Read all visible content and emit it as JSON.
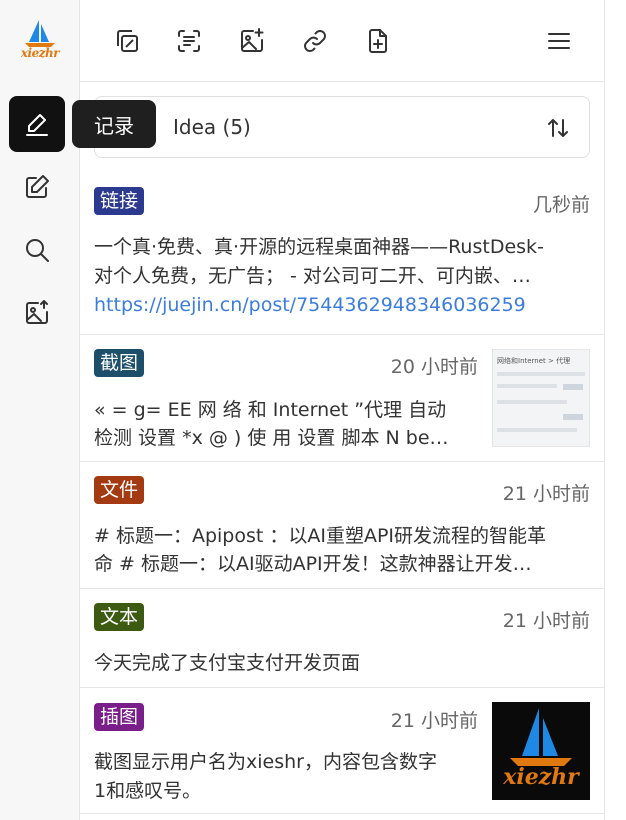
{
  "app": {
    "logo_text": "xiezhr",
    "colors": {
      "active_bg": "#111111",
      "link": "#3b7ddd"
    }
  },
  "sidebar": {
    "items": [
      {
        "name": "record",
        "icon": "pen-sign-icon",
        "active": true
      },
      {
        "name": "edit",
        "icon": "edit-icon",
        "active": false
      },
      {
        "name": "search",
        "icon": "search-icon",
        "active": false
      },
      {
        "name": "image-upload",
        "icon": "image-upload-icon",
        "active": false
      }
    ],
    "tooltip": "记录"
  },
  "toolbar": {
    "icons": [
      "copy-icon",
      "scan-text-icon",
      "image-plus-icon",
      "link-icon",
      "file-plus-icon",
      "menu-icon"
    ]
  },
  "filter": {
    "label": "Idea (5)"
  },
  "cards": [
    {
      "tag": "链接",
      "tag_color": "#2b3a8f",
      "time": "几秒前",
      "line1": "一个真·免费、真·开源的远程桌面神器——RustDesk-",
      "line2": "对个人免费，无广告； - 对公司可二开、可内嵌、…",
      "link": "https://juejin.cn/post/7544362948346036259"
    },
    {
      "tag": "截图",
      "tag_color": "#1d4f6a",
      "time": "20 小时前",
      "line1": "« = g= EE 网 络 和 Internet ”代理 自动",
      "line2": "检测 设置 *x @ ) 使 用 设置 脚本 N be…",
      "thumb_text": "网络和Internet > 代理"
    },
    {
      "tag": "文件",
      "tag_color": "#a33a12",
      "time": "21 小时前",
      "line1": "# 标题一：Apipost ：以AI重塑API研发流程的智能革",
      "line2": "命 # 标题一：以AI驱动API开发！这款神器让开发…"
    },
    {
      "tag": "文本",
      "tag_color": "#3d5a12",
      "time": "21 小时前",
      "line1": "今天完成了支付宝支付开发页面"
    },
    {
      "tag": "插图",
      "tag_color": "#7a1e8a",
      "time": "21 小时前",
      "line1": "截图显示用户名为xieshr，内容包含数字",
      "line2": "1和感叹号。",
      "thumb_text": "xiezhr"
    }
  ]
}
